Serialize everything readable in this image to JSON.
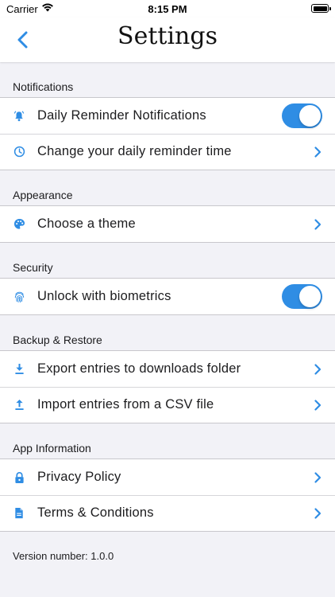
{
  "status_bar": {
    "carrier": "Carrier",
    "time": "8:15 PM"
  },
  "nav": {
    "title": "Settings"
  },
  "colors": {
    "accent": "#2f8de4",
    "background": "#f2f2f7"
  },
  "sections": [
    {
      "header": "Notifications",
      "rows": [
        {
          "icon": "bell-icon",
          "label": "Daily Reminder Notifications",
          "control": "toggle",
          "on": true
        },
        {
          "icon": "clock-icon",
          "label": "Change your daily reminder time",
          "control": "chevron"
        }
      ]
    },
    {
      "header": "Appearance",
      "rows": [
        {
          "icon": "palette-icon",
          "label": "Choose a theme",
          "control": "chevron"
        }
      ]
    },
    {
      "header": "Security",
      "rows": [
        {
          "icon": "fingerprint-icon",
          "label": "Unlock with biometrics",
          "control": "toggle",
          "on": true
        }
      ]
    },
    {
      "header": "Backup & Restore",
      "rows": [
        {
          "icon": "download-icon",
          "label": "Export entries to downloads folder",
          "control": "chevron"
        },
        {
          "icon": "upload-icon",
          "label": "Import entries from a CSV file",
          "control": "chevron"
        }
      ]
    },
    {
      "header": "App Information",
      "rows": [
        {
          "icon": "lock-icon",
          "label": "Privacy Policy",
          "control": "chevron"
        },
        {
          "icon": "document-icon",
          "label": "Terms & Conditions",
          "control": "chevron"
        }
      ]
    }
  ],
  "footer": {
    "version": "Version number: 1.0.0"
  }
}
